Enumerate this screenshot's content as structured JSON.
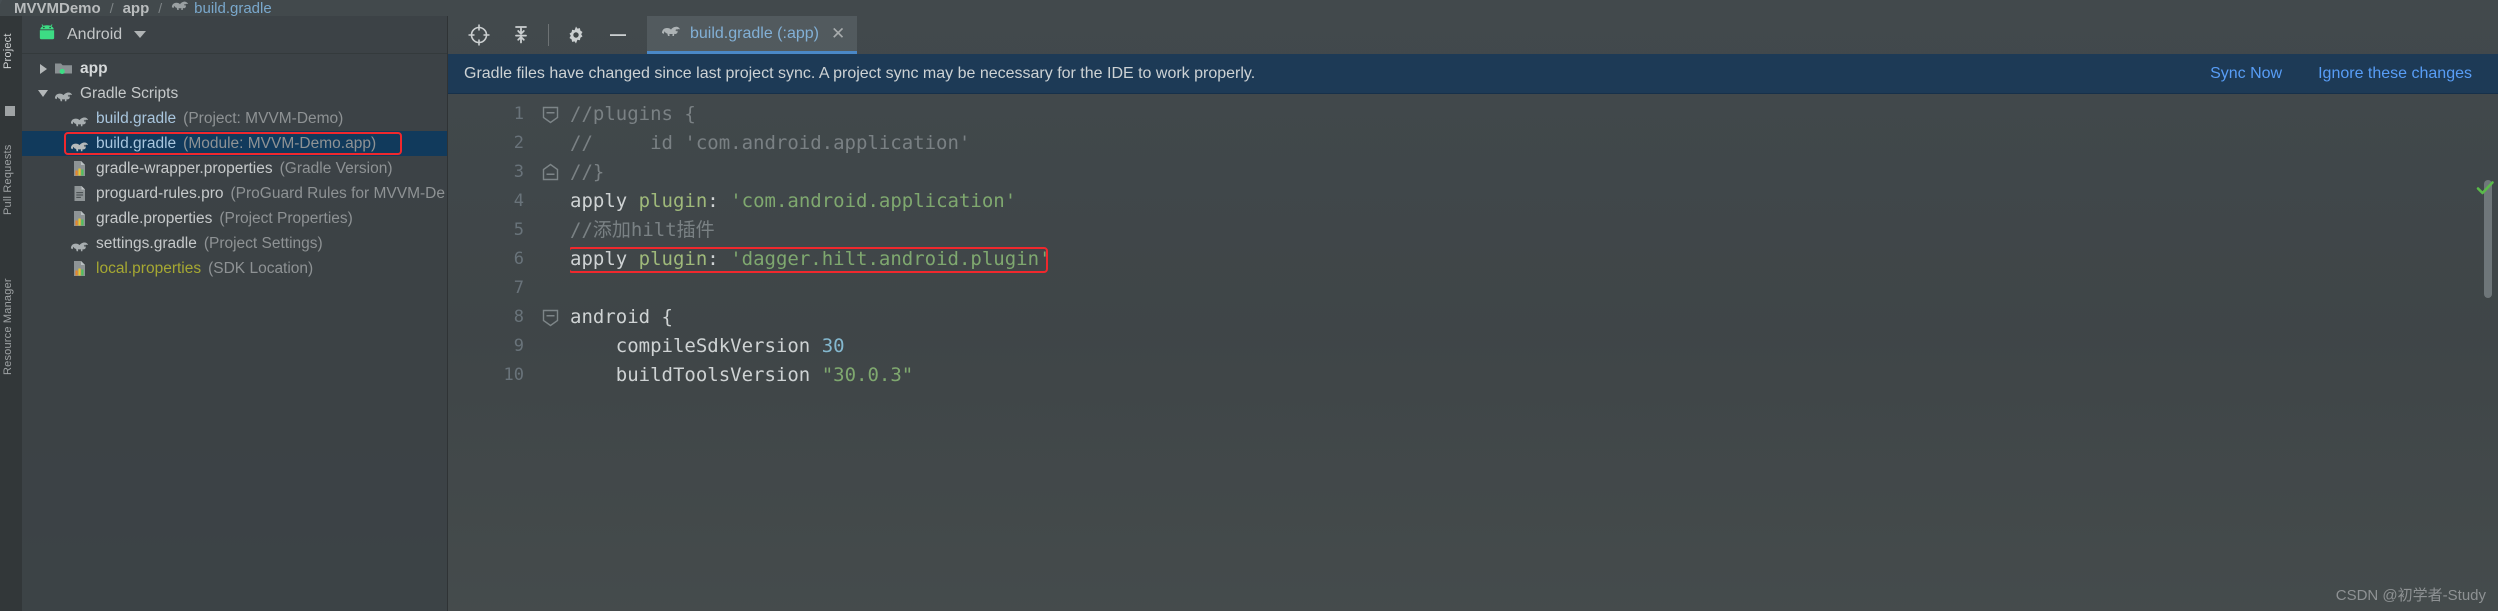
{
  "breadcrumb": {
    "items": [
      {
        "label": "MVVMDemo",
        "type": "project",
        "icon": null
      },
      {
        "label": "app",
        "type": "module",
        "icon": null
      },
      {
        "label": "build.gradle",
        "type": "file",
        "icon": "gradle-elephant-icon"
      }
    ],
    "separator": "/"
  },
  "left_tool_strip": {
    "tabs": [
      {
        "label": "Project",
        "active": true
      },
      {
        "label": "Pull Requests",
        "active": false
      },
      {
        "label": "Resource Manager",
        "active": false
      }
    ]
  },
  "project_panel": {
    "header": {
      "view_label": "Android",
      "icon": "android-robot-icon",
      "dropdown_icon": "chevron-down-icon"
    },
    "tree": [
      {
        "name": "app",
        "note": "",
        "icon": "module-folder-icon",
        "twisty": "collapsed",
        "indent": 0,
        "style": "bold",
        "selected": false
      },
      {
        "name": "Gradle Scripts",
        "note": "",
        "icon": "gradle-elephant-icon",
        "twisty": "expanded",
        "indent": 0,
        "style": "plain",
        "selected": false
      },
      {
        "name": "build.gradle",
        "note": "(Project: MVVM-Demo)",
        "icon": "gradle-elephant-icon",
        "twisty": "none",
        "indent": 1,
        "style": "link",
        "selected": false
      },
      {
        "name": "build.gradle",
        "note": "(Module: MVVM-Demo.app)",
        "icon": "gradle-elephant-icon",
        "twisty": "none",
        "indent": 1,
        "style": "link",
        "selected": true,
        "annotated": true
      },
      {
        "name": "gradle-wrapper.properties",
        "note": "(Gradle Version)",
        "icon": "properties-file-icon",
        "twisty": "none",
        "indent": 1,
        "style": "plain",
        "selected": false
      },
      {
        "name": "proguard-rules.pro",
        "note": "(ProGuard Rules for MVVM-De",
        "icon": "text-file-icon",
        "twisty": "none",
        "indent": 1,
        "style": "plain",
        "selected": false
      },
      {
        "name": "gradle.properties",
        "note": "(Project Properties)",
        "icon": "properties-file-icon",
        "twisty": "none",
        "indent": 1,
        "style": "plain",
        "selected": false
      },
      {
        "name": "settings.gradle",
        "note": "(Project Settings)",
        "icon": "gradle-elephant-icon",
        "twisty": "none",
        "indent": 1,
        "style": "plain",
        "selected": false
      },
      {
        "name": "local.properties",
        "note": "(SDK Location)",
        "icon": "properties-file-icon",
        "twisty": "none",
        "indent": 1,
        "style": "olive",
        "selected": false
      }
    ]
  },
  "editor": {
    "toolbar_icons": [
      {
        "name": "locate-target-icon"
      },
      {
        "name": "collapse-all-icon"
      },
      {
        "name": "settings-gear-icon"
      },
      {
        "name": "hide-panel-icon"
      }
    ],
    "tab": {
      "title": "build.gradle (:app)",
      "icon": "gradle-elephant-icon",
      "close_label": "✕",
      "active": true
    },
    "notification": {
      "message": "Gradle files have changed since last project sync. A project sync may be necessary for the IDE to work properly.",
      "actions": [
        "Sync Now",
        "Ignore these changes"
      ]
    },
    "line_numbers": [
      "1",
      "2",
      "3",
      "4",
      "5",
      "6",
      "7",
      "8",
      "9",
      "10"
    ],
    "folds": [
      {
        "line": 1,
        "type": "fold-start"
      },
      {
        "line": 3,
        "type": "fold-end"
      },
      {
        "line": 8,
        "type": "fold-start"
      }
    ],
    "code_lines": [
      {
        "n": 1,
        "tokens": [
          {
            "t": "//plugins {",
            "c": "comment"
          }
        ]
      },
      {
        "n": 2,
        "tokens": [
          {
            "t": "//     id 'com.android.application'",
            "c": "comment"
          }
        ]
      },
      {
        "n": 3,
        "tokens": [
          {
            "t": "//}",
            "c": "comment"
          }
        ]
      },
      {
        "n": 4,
        "tokens": [
          {
            "t": "apply",
            "c": "kw"
          },
          {
            "t": " ",
            "c": "punct"
          },
          {
            "t": "plugin",
            "c": "prop"
          },
          {
            "t": ":",
            "c": "punct"
          },
          {
            "t": " ",
            "c": "punct"
          },
          {
            "t": "'com.android.application'",
            "c": "str"
          }
        ]
      },
      {
        "n": 5,
        "tokens": [
          {
            "t": "//添加hilt插件",
            "c": "comment"
          }
        ]
      },
      {
        "n": 6,
        "annotated": true,
        "tokens": [
          {
            "t": "apply",
            "c": "kw"
          },
          {
            "t": " ",
            "c": "punct"
          },
          {
            "t": "plugin",
            "c": "prop"
          },
          {
            "t": ":",
            "c": "punct"
          },
          {
            "t": " ",
            "c": "punct"
          },
          {
            "t": "'dagger.hilt.android.plugin'",
            "c": "str"
          }
        ]
      },
      {
        "n": 7,
        "tokens": [
          {
            "t": "",
            "c": "punct"
          }
        ]
      },
      {
        "n": 8,
        "tokens": [
          {
            "t": "android",
            "c": "kw"
          },
          {
            "t": " {",
            "c": "punct"
          }
        ]
      },
      {
        "n": 9,
        "tokens": [
          {
            "t": "    ",
            "c": "punct"
          },
          {
            "t": "compileSdkVersion",
            "c": "kw"
          },
          {
            "t": " ",
            "c": "punct"
          },
          {
            "t": "30",
            "c": "num"
          }
        ]
      },
      {
        "n": 10,
        "tokens": [
          {
            "t": "    ",
            "c": "punct"
          },
          {
            "t": "buildToolsVersion",
            "c": "kw"
          },
          {
            "t": " ",
            "c": "punct"
          },
          {
            "t": "\"30.0.3\"",
            "c": "str"
          }
        ]
      }
    ],
    "inspection_status": "ok-check-icon"
  },
  "watermark": "CSDN @初学者-Study",
  "colors": {
    "selection_blue": "#113a5c",
    "annotation_red": "#f0282d",
    "tab_underline": "#4a88c7",
    "notification_bg": "#1d3a56",
    "link_blue": "#589df6",
    "string_green": "#7fa86f",
    "comment_gray": "#7a8184"
  }
}
